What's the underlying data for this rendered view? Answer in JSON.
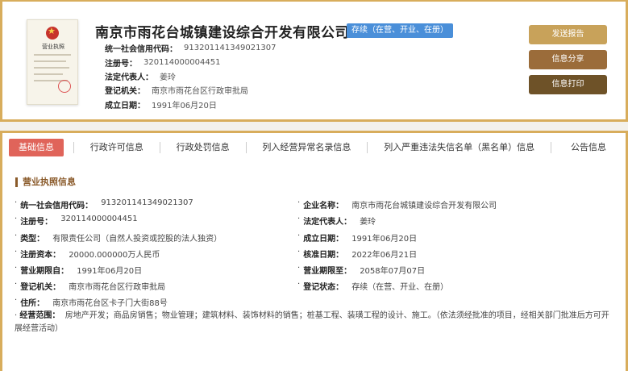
{
  "header": {
    "license_title": "营业执照",
    "company_name": "南京市雨花台城镇建设综合开发有限公司",
    "status": "存续（在营、开业、在册）",
    "fields": [
      {
        "label": "统一社会信用代码：",
        "value": "913201141349021307"
      },
      {
        "label": "注册号：",
        "value": "320114000004451"
      },
      {
        "label": "法定代表人：",
        "value": "姜玲"
      },
      {
        "label": "登记机关：",
        "value": "南京市雨花台区行政审批局"
      },
      {
        "label": "成立日期：",
        "value": "1991年06月20日"
      }
    ],
    "buttons": {
      "send": "发送报告",
      "share": "信息分享",
      "print": "信息打印"
    }
  },
  "tabs": [
    "基础信息",
    "行政许可信息",
    "行政处罚信息",
    "列入经营异常名录信息",
    "列入严重违法失信名单（黑名单）信息",
    "公告信息"
  ],
  "section": {
    "title": "营业执照信息",
    "left": [
      {
        "label": "统一社会信用代码：",
        "value": "913201141349021307"
      },
      {
        "label": "注册号：",
        "value": "320114000004451"
      },
      {
        "label": "类型：",
        "value": "有限责任公司（自然人投资或控股的法人独资）"
      },
      {
        "label": "注册资本：",
        "value": "20000.000000万人民币"
      },
      {
        "label": "营业期限自：",
        "value": "1991年06月20日"
      },
      {
        "label": "登记机关：",
        "value": "南京市雨花台区行政审批局"
      },
      {
        "label": "住所：",
        "value": "南京市雨花台区卡子门大街88号"
      }
    ],
    "right": [
      {
        "label": "企业名称：",
        "value": "南京市雨花台城镇建设综合开发有限公司"
      },
      {
        "label": "法定代表人：",
        "value": "姜玲"
      },
      {
        "label": "成立日期：",
        "value": "1991年06月20日"
      },
      {
        "label": "核准日期：",
        "value": "2022年06月21日"
      },
      {
        "label": "营业期限至：",
        "value": "2058年07月07日"
      },
      {
        "label": "登记状态：",
        "value": "存续（在营、开业、在册）"
      }
    ],
    "scope": {
      "label": "经营范围：",
      "value": "房地产开发；商品房销售；物业管理；建筑材料、装饰材料的销售；桩基工程、装璜工程的设计、施工。（依法须经批准的项目，经相关部门批准后方可开展经营活动）"
    }
  },
  "colors": {
    "border_gold": "#d8ad5c",
    "status_blue": "#4a8fd9",
    "tab_active": "#e0645a",
    "btn_send": "#c8a25a",
    "btn_share": "#9b6c3a",
    "btn_print": "#6e5228"
  }
}
